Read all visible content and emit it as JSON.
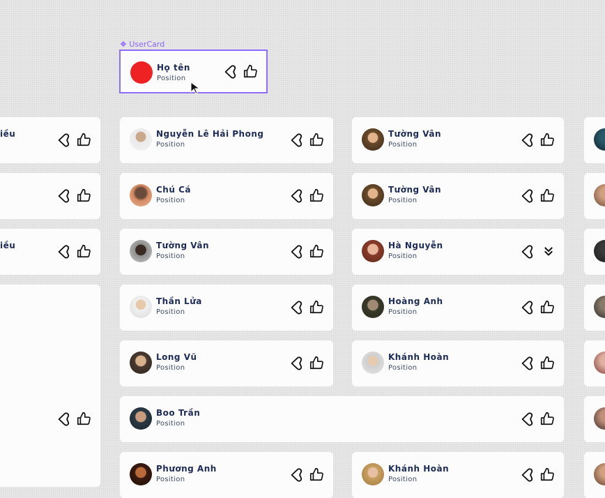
{
  "component": {
    "label": "UserCard",
    "label_icon": "component-icon",
    "name": "Họ tên",
    "position": "Position",
    "avatar_color": "#ee2222"
  },
  "left_column": {
    "cards": [
      {
        "name": "iều"
      },
      {
        "name": ""
      },
      {
        "name": "iều"
      },
      {
        "name": ""
      }
    ]
  },
  "column_1": {
    "cards": [
      {
        "name": "Nguyễn Lê Hải Phong",
        "position": "Position"
      },
      {
        "name": "Chú Cá",
        "position": "Position"
      },
      {
        "name": "Tường Vân",
        "position": "Position"
      },
      {
        "name": "Thần Lửa",
        "position": "Position"
      },
      {
        "name": "Long Vũ",
        "position": "Position"
      },
      {
        "name": "Boo Trần",
        "position": "Position"
      },
      {
        "name": "Phương Anh",
        "position": "Position"
      }
    ]
  },
  "column_2": {
    "cards": [
      {
        "name": "Tường Vân",
        "position": "Position"
      },
      {
        "name": "Tường Vân",
        "position": "Position"
      },
      {
        "name": "Hà Nguyễn",
        "position": "Position"
      },
      {
        "name": "Hoàng Anh",
        "position": "Position"
      },
      {
        "name": "Khánh Hoàn",
        "position": "Position"
      },
      {
        "name": "Khánh Hoàn",
        "position": "Position"
      }
    ]
  },
  "colors": {
    "accent": "#8f6bff",
    "name_text": "#1d2b57",
    "card_bg": "#fcfcfc"
  },
  "icons": [
    "heart-icon",
    "thumbs-up-icon",
    "double-chevron-down-icon",
    "cursor-icon"
  ]
}
